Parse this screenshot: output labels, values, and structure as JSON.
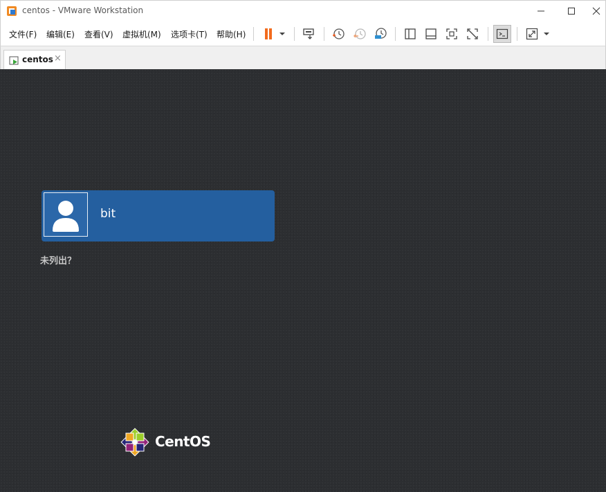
{
  "window": {
    "title": "centos - VMware Workstation"
  },
  "menu": {
    "items": [
      {
        "label": "文件(F)"
      },
      {
        "label": "编辑(E)"
      },
      {
        "label": "查看(V)"
      },
      {
        "label": "虚拟机(M)"
      },
      {
        "label": "选项卡(T)"
      },
      {
        "label": "帮助(H)"
      }
    ]
  },
  "toolbar": {
    "icons": [
      "pause-icon",
      "dropdown-arrow-icon",
      "send-ctrl-alt-del-icon",
      "snapshot-icon",
      "revert-snapshot-icon",
      "snapshot-manager-icon",
      "show-library-icon",
      "thumbnail-bar-icon",
      "full-screen-icon",
      "unity-icon",
      "console-view-icon",
      "stretch-guest-icon"
    ],
    "accent_color": "#f26b1d"
  },
  "tabs": [
    {
      "label": "centos",
      "close": "×"
    }
  ],
  "vm": {
    "user_name": "bit",
    "not_listed": "未列出？",
    "os_brand": "CentOS"
  },
  "colors": {
    "screen_bg": "#2c2e31",
    "user_card": "#245f9f"
  }
}
